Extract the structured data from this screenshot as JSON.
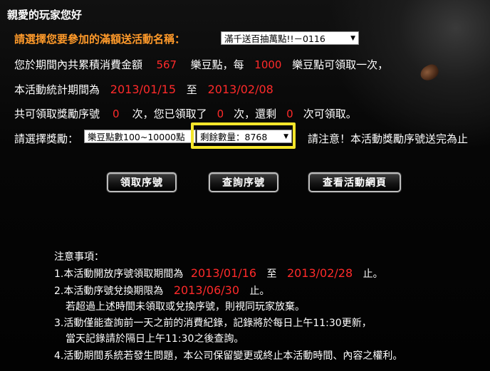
{
  "title": "親愛的玩家您好",
  "activity": {
    "label": "請選擇您要參加的滿額送活動名稱：",
    "selected": "滿千送百抽萬點!!－0116"
  },
  "spend": {
    "prefix": "您於期間內共累積消費金額",
    "amount": "567",
    "mid": "樂豆點，每",
    "unit_amount": "1000",
    "suffix": "樂豆點可領取一次，"
  },
  "period": {
    "prefix": "本活動統計期間為",
    "start": "2013/01/15",
    "to": "至",
    "end": "2013/02/08"
  },
  "counts": {
    "prefix": "共可領取獎勵序號",
    "total": "0",
    "mid1": "次，您已領取了",
    "claimed": "0",
    "mid2": "次，還剩",
    "remaining": "0",
    "suffix": "次可領取。"
  },
  "reward": {
    "label": "請選擇獎勵：",
    "selected": "樂豆點數100~10000點",
    "remaining_selected": "剩餘數量：8768",
    "notice": "請注意！本活動獎勵序號送完為止"
  },
  "buttons": {
    "claim": "領取序號",
    "query": "查詢序號",
    "view_page": "查看活動網頁"
  },
  "notes": {
    "heading": "注意事項：",
    "item1_prefix": "1.本活動開放序號領取期間為",
    "item1_start": "2013/01/16",
    "item1_to": "至",
    "item1_end": "2013/02/28",
    "item1_suffix": "止。",
    "item2_prefix": "2.本活動序號兌換期限為",
    "item2_date": "2013/06/30",
    "item2_suffix": "止。",
    "item2_detail": "若超過上述時間未領取或兌換序號，則視同玩家放棄。",
    "item3": "3.活動僅能查詢前一天之前的消費紀錄，記錄將於每日上午11:30更新，",
    "item3_detail": "當天記錄請於隔日上午11:30之後查詢。",
    "item4": "4.活動期間系統若發生問題，本公司保留變更或終止本活動時間、內容之權利。"
  },
  "colors": {
    "accent_orange": "#ff9a2a",
    "value_red": "#ff2a2a",
    "highlight_yellow": "#f5e62a"
  }
}
